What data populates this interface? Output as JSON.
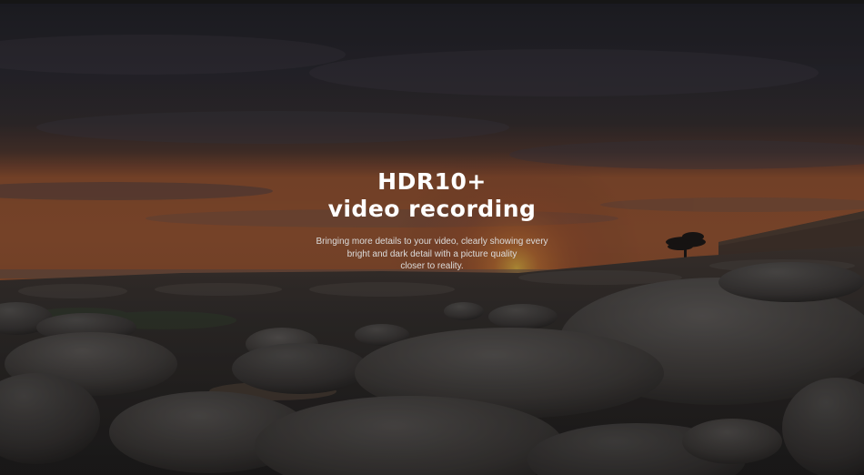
{
  "hero": {
    "title_line1": "HDR10+",
    "title_line2": "video recording",
    "desc_line1": "Bringing more details to your video, clearly showing every",
    "desc_line2": "bright and dark detail with a picture quality",
    "desc_line3": "closer to reality."
  },
  "colors": {
    "sky_top": "#2c2c34",
    "horizon_glow": "#c46a3a",
    "text": "#ffffff"
  },
  "background_icon": "sunset-rocky-beach-photo"
}
